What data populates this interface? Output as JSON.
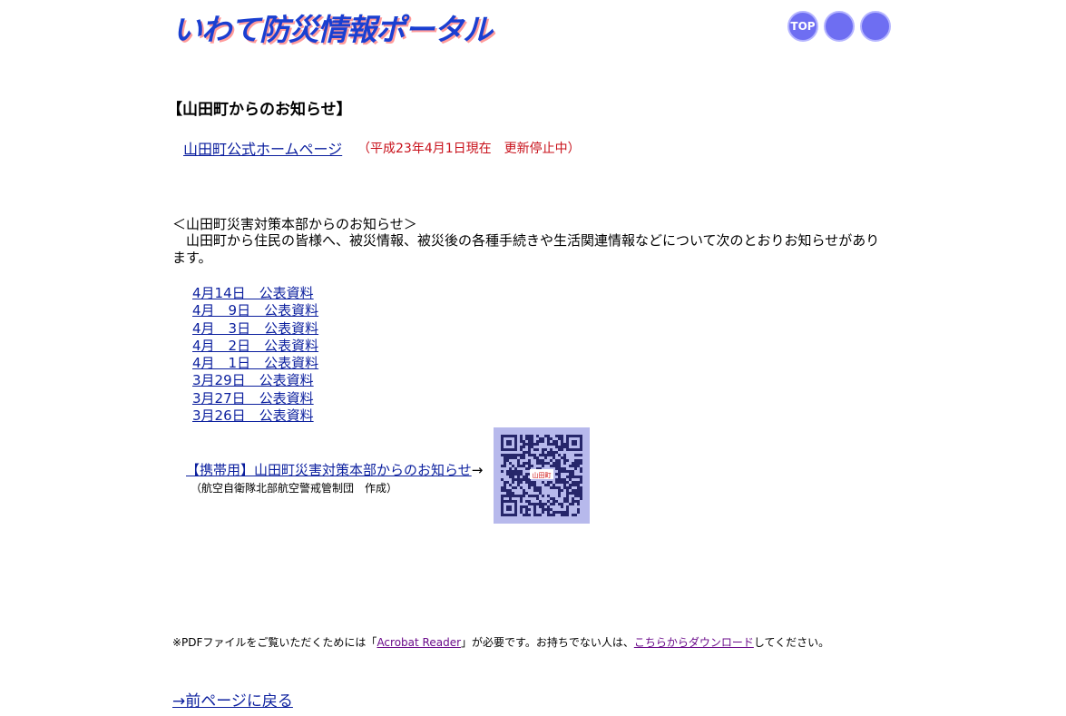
{
  "header": {
    "logo_text": "いわて防災情報ポータル",
    "nav_top_label": "TOP"
  },
  "main": {
    "heading": "【山田町からのお知らせ】",
    "hp_link_label": "山田町公式ホームページ",
    "hp_note": "（平成23年4月1日現在　更新停止中）",
    "sub_heading": "＜山田町災害対策本部からのお知らせ＞",
    "intro": "　山田町から住民の皆様へ、被災情報、被災後の各種手続きや生活関連情報などについて次のとおりお知らせがあります。",
    "documents": [
      "4月14日　公表資料",
      "4月　9日　公表資料",
      "4月　3日　公表資料",
      "4月　2日　公表資料",
      "4月　1日　公表資料",
      "3月29日　公表資料",
      "3月27日　公表資料",
      "3月26日　公表資料"
    ],
    "mobile_link_label": "【携帯用】山田町災害対策本部からのお知らせ",
    "mobile_arrow": "→",
    "mobile_credit": "（航空自衛隊北部航空警戒管制団　作成）",
    "qr_center_text": "山田町"
  },
  "footer": {
    "pdf_prefix": "※PDFファイルをご覧いただくためには「",
    "acrobat_label": "Acrobat Reader",
    "pdf_middle": "」が必要です。お持ちでない人は、",
    "download_label": "こちらからダウンロード",
    "pdf_suffix": "してください。",
    "back_label": "→前ページに戻る"
  },
  "colors": {
    "link": "#0b1f9e",
    "notice_red": "#c8101a",
    "qr_background": "#b7b9ec",
    "nav_circle": "#6e6ef2"
  }
}
